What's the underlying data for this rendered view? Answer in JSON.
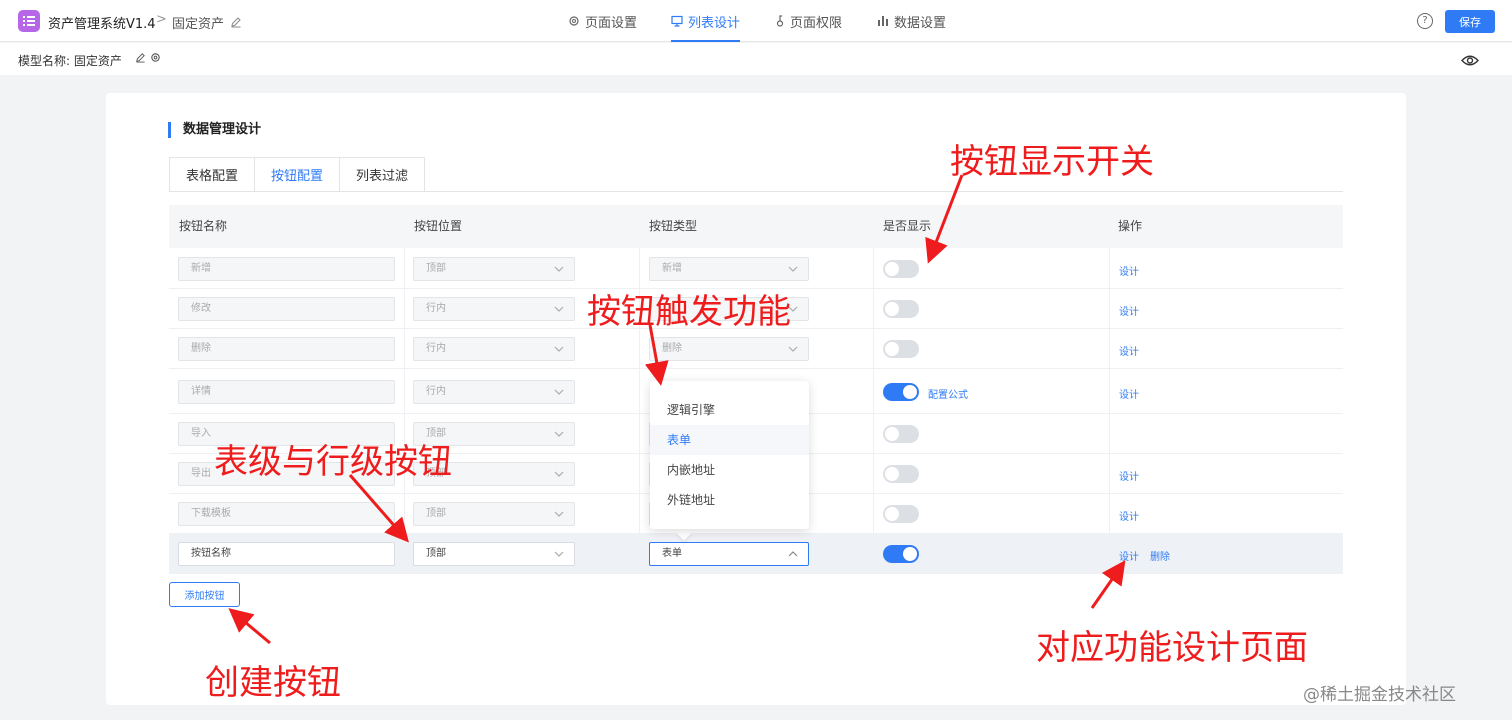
{
  "header": {
    "app_title": "资产管理系统V1.4",
    "breadcrumb_sep": ">",
    "current_page": "固定资产",
    "nav": [
      {
        "label": "页面设置",
        "icon": "gear-icon"
      },
      {
        "label": "列表设计",
        "icon": "list-design-icon"
      },
      {
        "label": "页面权限",
        "icon": "key-icon"
      },
      {
        "label": "数据设置",
        "icon": "bar-chart-icon"
      }
    ],
    "help_label": "?",
    "save_label": "保存"
  },
  "subbar": {
    "model_label": "模型名称: 固定资产"
  },
  "section": {
    "title": "数据管理设计",
    "tabs": [
      "表格配置",
      "按钮配置",
      "列表过滤"
    ],
    "active_tab": 1
  },
  "table": {
    "columns": [
      "按钮名称",
      "按钮位置",
      "按钮类型",
      "是否显示",
      "操作"
    ],
    "rows": [
      {
        "name": "新增",
        "position": "顶部",
        "type": "新增",
        "visible": false,
        "formula": "",
        "actions": [
          "设计"
        ]
      },
      {
        "name": "修改",
        "position": "行内",
        "type": "",
        "visible": false,
        "formula": "",
        "actions": [
          "设计"
        ]
      },
      {
        "name": "删除",
        "position": "行内",
        "type": "删除",
        "visible": false,
        "formula": "",
        "actions": [
          "设计"
        ]
      },
      {
        "name": "详情",
        "position": "行内",
        "type": "",
        "visible": true,
        "formula": "配置公式",
        "actions": [
          "设计"
        ]
      },
      {
        "name": "导入",
        "position": "顶部",
        "type": "",
        "visible": false,
        "formula": "",
        "actions": []
      },
      {
        "name": "导出",
        "position": "顶部",
        "type": "",
        "visible": false,
        "formula": "",
        "actions": [
          "设计"
        ]
      },
      {
        "name": "下载模板",
        "position": "顶部",
        "type": "",
        "visible": false,
        "formula": "",
        "actions": [
          "设计"
        ]
      },
      {
        "name": "按钮名称",
        "position": "顶部",
        "type": "表单",
        "visible": true,
        "formula": "",
        "actions": [
          "设计",
          "删除"
        ]
      }
    ],
    "add_button_label": "添加按钮"
  },
  "dropdown": {
    "options": [
      "逻辑引擎",
      "表单",
      "内嵌地址",
      "外链地址"
    ],
    "selected": "表单"
  },
  "annotations": {
    "toggle": "按钮显示开关",
    "trigger": "按钮触发功能",
    "level": "表级与行级按钮",
    "create": "创建按钮",
    "design": "对应功能设计页面"
  },
  "watermark": "@稀土掘金技术社区",
  "colors": {
    "accent": "#2f7bf6",
    "annotation": "#ee1c1c",
    "logo": "#b667e8"
  }
}
